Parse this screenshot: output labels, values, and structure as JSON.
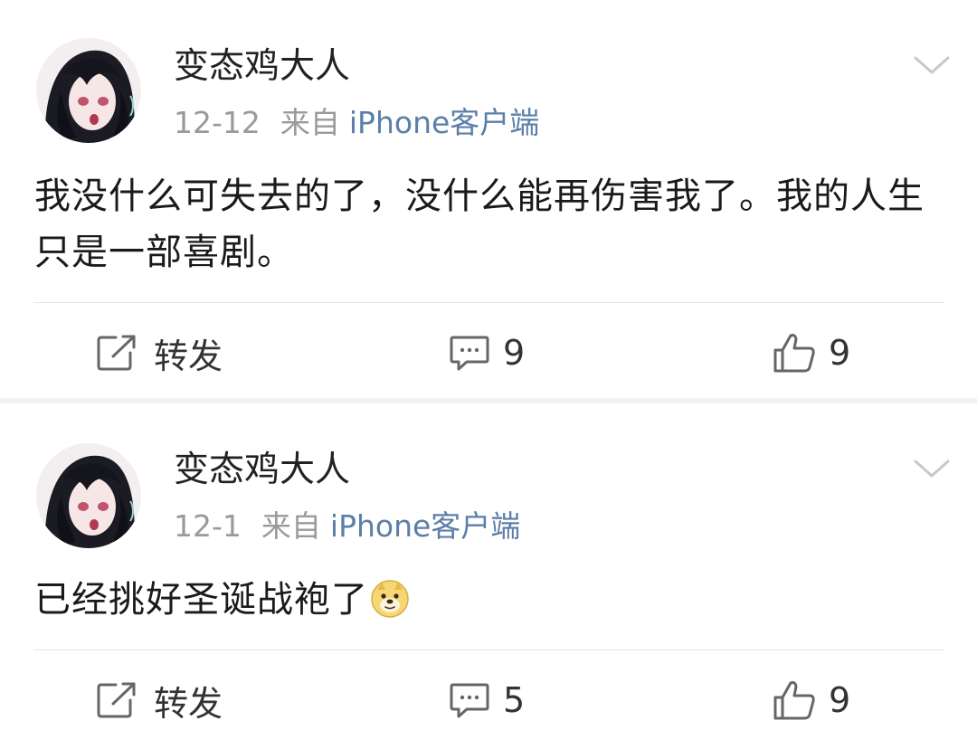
{
  "posts": [
    {
      "username": "变态鸡大人",
      "date": "12-12",
      "source_prefix": "来自",
      "source_client": "iPhone客户端",
      "content": "我没什么可失去的了，没什么能再伤害我了。我的人生只是一部喜剧。",
      "has_emoji": false,
      "actions": {
        "repost_label": "转发",
        "comment_count": "9",
        "like_count": "9"
      }
    },
    {
      "username": "变态鸡大人",
      "date": "12-1",
      "source_prefix": "来自",
      "source_client": "iPhone客户端",
      "content": "已经挑好圣诞战袍了",
      "has_emoji": true,
      "emoji_name": "doge-emoji",
      "actions": {
        "repost_label": "转发",
        "comment_count": "5",
        "like_count": "9"
      }
    }
  ],
  "colors": {
    "username": "#222222",
    "meta_gray": "#9a9a9a",
    "client_link": "#5b7fa8",
    "content": "#1a1a1a",
    "icon_gray": "#666666",
    "divider": "#e6e6e6"
  },
  "icons": {
    "more": "chevron-down-icon",
    "repost": "edit-repost-icon",
    "comment": "comment-icon",
    "like": "thumbs-up-icon"
  }
}
